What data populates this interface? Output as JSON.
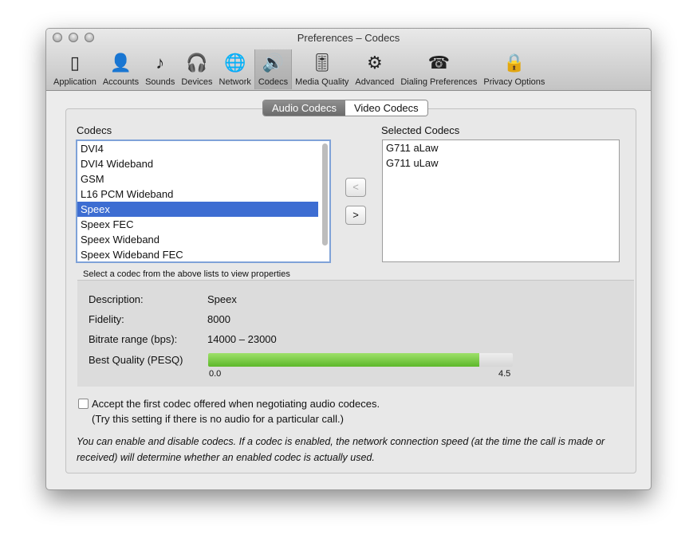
{
  "window": {
    "title": "Preferences – Codecs"
  },
  "toolbar": [
    {
      "label": "Application",
      "icon": "switch-icon",
      "glyph": "▯"
    },
    {
      "label": "Accounts",
      "icon": "user-icon",
      "glyph": "👤"
    },
    {
      "label": "Sounds",
      "icon": "music-note-icon",
      "glyph": "♪"
    },
    {
      "label": "Devices",
      "icon": "headset-icon",
      "glyph": "🎧"
    },
    {
      "label": "Network",
      "icon": "globe-icon",
      "glyph": "🌐"
    },
    {
      "label": "Codecs",
      "icon": "speaker-chip-icon",
      "glyph": "🔊",
      "active": true
    },
    {
      "label": "Media Quality",
      "icon": "equalizer-check-icon",
      "glyph": "🎚"
    },
    {
      "label": "Advanced",
      "icon": "gear-icon",
      "glyph": "⚙"
    },
    {
      "label": "Dialing Preferences",
      "icon": "phone-dial-icon",
      "glyph": "☎"
    },
    {
      "label": "Privacy Options",
      "icon": "keyhole-icon",
      "glyph": "🔒"
    }
  ],
  "tabs": [
    {
      "label": "Audio Codecs",
      "selected": true
    },
    {
      "label": "Video Codecs"
    }
  ],
  "codecs": {
    "label": "Codecs",
    "items": [
      "DVI4",
      "DVI4 Wideband",
      "GSM",
      "L16 PCM Wideband",
      "Speex",
      "Speex FEC",
      "Speex Wideband",
      "Speex Wideband FEC"
    ],
    "selected": "Speex"
  },
  "selected_codecs": {
    "label": "Selected Codecs",
    "items": [
      "G711 aLaw",
      "G711 uLaw"
    ]
  },
  "buttons": {
    "remove": "<",
    "add": ">"
  },
  "properties": {
    "hint": "Select a codec from the above lists to view properties",
    "description_label": "Description:",
    "description": "Speex",
    "fidelity_label": "Fidelity:",
    "fidelity": "8000",
    "bitrate_label": "Bitrate range (bps):",
    "bitrate": "14000 – 23000",
    "quality_label": "Best Quality (PESQ)",
    "quality_min": "0.0",
    "quality_max": "4.5",
    "quality_value": 4.0
  },
  "accept_first": {
    "label": "Accept the first codec offered when negotiating audio codeces.",
    "hint": "(Try this setting if there is no audio for a particular call.)",
    "checked": false
  },
  "note": "You can enable and disable codecs. If a codec is enabled, the network connection speed (at the time the call is made or received) will determine whether an enabled codec is actually used."
}
